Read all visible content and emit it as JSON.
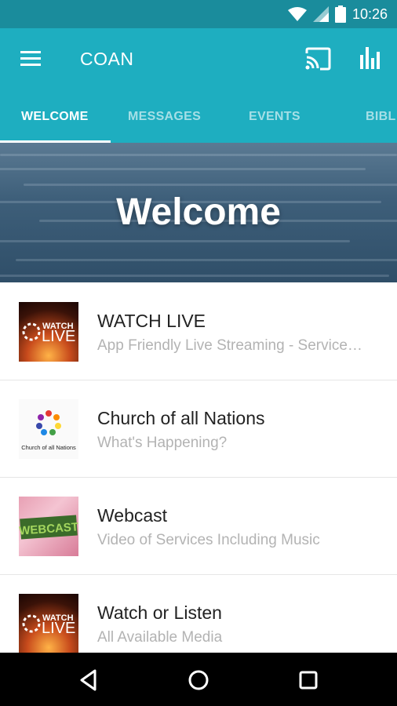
{
  "status_bar": {
    "time": "10:26"
  },
  "app_bar": {
    "title": "COAN"
  },
  "tabs": [
    {
      "label": "WELCOME",
      "active": true
    },
    {
      "label": "MESSAGES",
      "active": false
    },
    {
      "label": "EVENTS",
      "active": false
    },
    {
      "label": "BIBL",
      "active": false
    }
  ],
  "hero": {
    "title": "Welcome"
  },
  "list": [
    {
      "title": "WATCH LIVE",
      "subtitle": "App Friendly Live Streaming - Service…",
      "thumb_text_top": "WATCH",
      "thumb_text_bottom": "LIVE"
    },
    {
      "title": "Church of all Nations",
      "subtitle": "What's Happening?",
      "thumb_text": "Church of all Nations"
    },
    {
      "title": "Webcast",
      "subtitle": "Video of Services Including Music",
      "thumb_text": "WEBCAST"
    },
    {
      "title": "Watch or Listen",
      "subtitle": "All Available Media",
      "thumb_text_top": "WATCH",
      "thumb_text_bottom": "LIVE"
    }
  ],
  "colors": {
    "status_bar": "#1a8c9c",
    "app_bar": "#1eaec0",
    "nav_bar": "#000000"
  },
  "icons": [
    "wifi-icon",
    "signal-icon",
    "battery-icon",
    "menu-icon",
    "cast-icon",
    "chart-icon",
    "back-icon",
    "home-icon",
    "recents-icon"
  ]
}
